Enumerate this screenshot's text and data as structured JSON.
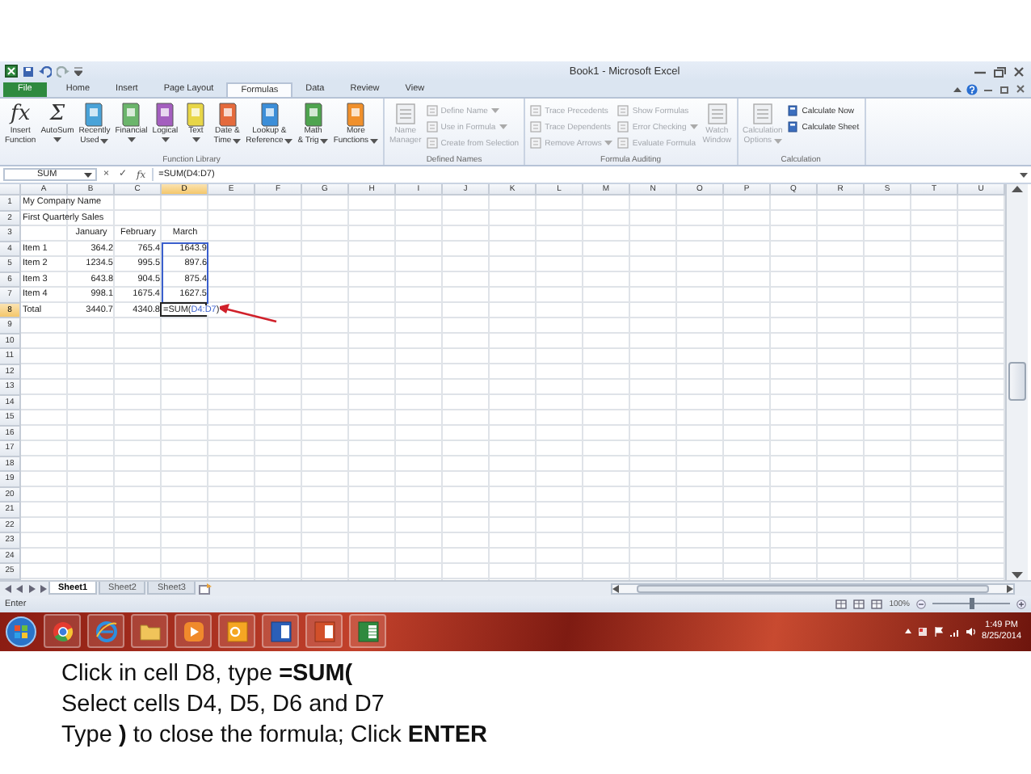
{
  "window": {
    "title": "Book1 - Microsoft Excel"
  },
  "tabs": [
    {
      "label": "File",
      "kind": "file",
      "selected": false
    },
    {
      "label": "Home",
      "kind": "tab",
      "selected": false
    },
    {
      "label": "Insert",
      "kind": "tab",
      "selected": false
    },
    {
      "label": "Page Layout",
      "kind": "tab",
      "selected": false
    },
    {
      "label": "Formulas",
      "kind": "tab",
      "selected": true
    },
    {
      "label": "Data",
      "kind": "tab",
      "selected": false
    },
    {
      "label": "Review",
      "kind": "tab",
      "selected": false
    },
    {
      "label": "View",
      "kind": "tab",
      "selected": false
    }
  ],
  "ribbon": {
    "groups": [
      {
        "name": "Function Library",
        "items": [
          {
            "kind": "large",
            "glyph": "fx",
            "lines": [
              "Insert",
              "Function"
            ],
            "dropdown": false,
            "disabled": false
          },
          {
            "kind": "large",
            "glyph": "Σ",
            "lines": [
              "AutoSum"
            ],
            "dropdown": true,
            "disabled": false
          },
          {
            "kind": "large",
            "lines": [
              "Recently",
              "Used"
            ],
            "dropdown": true,
            "disabled": false
          },
          {
            "kind": "large",
            "lines": [
              "Financial"
            ],
            "dropdown": true,
            "disabled": false
          },
          {
            "kind": "large",
            "lines": [
              "Logical"
            ],
            "dropdown": true,
            "disabled": false
          },
          {
            "kind": "large",
            "lines": [
              "Text"
            ],
            "dropdown": true,
            "disabled": false
          },
          {
            "kind": "large",
            "lines": [
              "Date &",
              "Time"
            ],
            "dropdown": true,
            "disabled": false
          },
          {
            "kind": "large",
            "lines": [
              "Lookup &",
              "Reference"
            ],
            "dropdown": true,
            "disabled": false
          },
          {
            "kind": "large",
            "lines": [
              "Math",
              "& Trig"
            ],
            "dropdown": true,
            "disabled": false
          },
          {
            "kind": "large",
            "lines": [
              "More",
              "Functions"
            ],
            "dropdown": true,
            "disabled": false
          }
        ]
      },
      {
        "name": "Defined Names",
        "items": [
          {
            "kind": "large",
            "lines": [
              "Name",
              "Manager"
            ],
            "dropdown": false,
            "disabled": true
          },
          {
            "kind": "small",
            "lines": [
              "Define Name"
            ],
            "dropdown": true,
            "disabled": true
          },
          {
            "kind": "small",
            "lines": [
              "Use in Formula"
            ],
            "dropdown": true,
            "disabled": true
          },
          {
            "kind": "small",
            "lines": [
              "Create from Selection"
            ],
            "dropdown": false,
            "disabled": true
          }
        ]
      },
      {
        "name": "Formula Auditing",
        "items": [
          {
            "kind": "small",
            "lines": [
              "Trace Precedents"
            ],
            "dropdown": false,
            "disabled": true
          },
          {
            "kind": "small",
            "lines": [
              "Trace Dependents"
            ],
            "dropdown": false,
            "disabled": true
          },
          {
            "kind": "small",
            "lines": [
              "Remove Arrows"
            ],
            "dropdown": true,
            "disabled": true
          },
          {
            "kind": "small",
            "lines": [
              "Show Formulas"
            ],
            "dropdown": false,
            "disabled": true
          },
          {
            "kind": "small",
            "lines": [
              "Error Checking"
            ],
            "dropdown": true,
            "disabled": true
          },
          {
            "kind": "small",
            "lines": [
              "Evaluate Formula"
            ],
            "dropdown": false,
            "disabled": true
          },
          {
            "kind": "large",
            "lines": [
              "Watch",
              "Window"
            ],
            "dropdown": false,
            "disabled": true
          }
        ]
      },
      {
        "name": "Calculation",
        "items": [
          {
            "kind": "large",
            "lines": [
              "Calculation",
              "Options"
            ],
            "dropdown": true,
            "disabled": true
          },
          {
            "kind": "small",
            "lines": [
              "Calculate Now"
            ],
            "dropdown": false,
            "disabled": false
          },
          {
            "kind": "small",
            "lines": [
              "Calculate Sheet"
            ],
            "dropdown": false,
            "disabled": false
          }
        ]
      }
    ]
  },
  "formula_bar": {
    "name_box": "SUM",
    "buttons": [
      "×",
      "✓",
      "fx"
    ],
    "formula": "=SUM(D4:D7)"
  },
  "columns": [
    {
      "label": "A",
      "selected": false
    },
    {
      "label": "B",
      "selected": false
    },
    {
      "label": "C",
      "selected": false
    },
    {
      "label": "D",
      "selected": true
    },
    {
      "label": "E",
      "selected": false
    },
    {
      "label": "F",
      "selected": false
    },
    {
      "label": "G",
      "selected": false
    },
    {
      "label": "H",
      "selected": false
    },
    {
      "label": "I",
      "selected": false
    },
    {
      "label": "J",
      "selected": false
    },
    {
      "label": "K",
      "selected": false
    },
    {
      "label": "L",
      "selected": false
    },
    {
      "label": "M",
      "selected": false
    },
    {
      "label": "N",
      "selected": false
    },
    {
      "label": "O",
      "selected": false
    },
    {
      "label": "P",
      "selected": false
    },
    {
      "label": "Q",
      "selected": false
    },
    {
      "label": "R",
      "selected": false
    },
    {
      "label": "S",
      "selected": false
    },
    {
      "label": "T",
      "selected": false
    },
    {
      "label": "U",
      "selected": false
    }
  ],
  "rows": [
    {
      "label": "1",
      "selected": false,
      "cells": {
        "A": {
          "kind": "text",
          "text": "My Company Name"
        }
      }
    },
    {
      "label": "2",
      "selected": false,
      "cells": {
        "A": {
          "kind": "text",
          "text": "First Quarterly Sales"
        }
      }
    },
    {
      "label": "3",
      "selected": false,
      "cells": {
        "B": {
          "kind": "header",
          "text": "January"
        },
        "C": {
          "kind": "header",
          "text": "February"
        },
        "D": {
          "kind": "header",
          "text": "March"
        }
      }
    },
    {
      "label": "4",
      "selected": false,
      "cells": {
        "A": {
          "kind": "text",
          "text": "Item 1"
        },
        "B": {
          "kind": "number",
          "text": "364.2"
        },
        "C": {
          "kind": "number",
          "text": "765.4"
        },
        "D": {
          "kind": "number",
          "text": "1643.9",
          "referenced": true
        }
      }
    },
    {
      "label": "5",
      "selected": false,
      "cells": {
        "A": {
          "kind": "text",
          "text": "Item 2"
        },
        "B": {
          "kind": "number",
          "text": "1234.5"
        },
        "C": {
          "kind": "number",
          "text": "995.5"
        },
        "D": {
          "kind": "number",
          "text": "897.6",
          "referenced": true
        }
      }
    },
    {
      "label": "6",
      "selected": false,
      "cells": {
        "A": {
          "kind": "text",
          "text": "Item 3"
        },
        "B": {
          "kind": "number",
          "text": "643.8"
        },
        "C": {
          "kind": "number",
          "text": "904.5"
        },
        "D": {
          "kind": "number",
          "text": "875.4",
          "referenced": true
        }
      }
    },
    {
      "label": "7",
      "selected": false,
      "cells": {
        "A": {
          "kind": "text",
          "text": "Item 4"
        },
        "B": {
          "kind": "number",
          "text": "998.1"
        },
        "C": {
          "kind": "number",
          "text": "1675.4"
        },
        "D": {
          "kind": "number",
          "text": "1627.5",
          "referenced": true
        }
      }
    },
    {
      "label": "8",
      "selected": true,
      "cells": {
        "A": {
          "kind": "text",
          "text": "Total"
        },
        "B": {
          "kind": "number",
          "text": "3440.7"
        },
        "C": {
          "kind": "number",
          "text": "4340.8"
        },
        "D": {
          "kind": "formula",
          "active": true,
          "parts": [
            {
              "kind": "plain",
              "text": "=SUM("
            },
            {
              "kind": "reference",
              "text": "D4:D7"
            },
            {
              "kind": "plain",
              "text": ")"
            }
          ]
        }
      }
    },
    {
      "label": "9",
      "selected": false
    },
    {
      "label": "10",
      "selected": false
    },
    {
      "label": "11",
      "selected": false
    },
    {
      "label": "12",
      "selected": false
    },
    {
      "label": "13",
      "selected": false
    },
    {
      "label": "14",
      "selected": false
    },
    {
      "label": "15",
      "selected": false
    },
    {
      "label": "16",
      "selected": false
    },
    {
      "label": "17",
      "selected": false
    },
    {
      "label": "18",
      "selected": false
    },
    {
      "label": "19",
      "selected": false
    },
    {
      "label": "20",
      "selected": false
    },
    {
      "label": "21",
      "selected": false
    },
    {
      "label": "22",
      "selected": false
    },
    {
      "label": "23",
      "selected": false
    },
    {
      "label": "24",
      "selected": false
    },
    {
      "label": "25",
      "selected": false
    }
  ],
  "sheet_tabs": [
    {
      "label": "Sheet1",
      "selected": true
    },
    {
      "label": "Sheet2",
      "selected": false
    },
    {
      "label": "Sheet3",
      "selected": false
    }
  ],
  "status_bar": {
    "mode": "Enter",
    "zoom": {
      "text": "100%",
      "level": 0.5
    }
  },
  "taskbar": {
    "time": "1:49 PM",
    "date": "8/25/2014"
  },
  "caption": {
    "lines": [
      "Click in cell D8, type **=SUM(**",
      "Select cells D4, D5, D6 and D7",
      "Type **)** to close the formula; Click **ENTER**"
    ]
  }
}
